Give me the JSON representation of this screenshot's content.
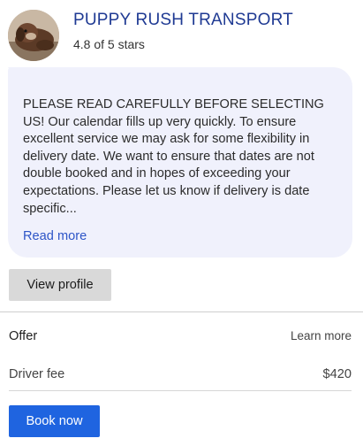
{
  "company": {
    "name": "PUPPY RUSH TRANSPORT",
    "rating_text": "4.8 of 5 stars",
    "avatar_icon": "dog-photo-avatar"
  },
  "description": {
    "text": "PLEASE READ CAREFULLY BEFORE SELECTING US! Our calendar fills up very quickly. To ensure excellent service we may ask for some flexibility in delivery date. We want to ensure that dates are not double booked and in hopes of exceeding your expectations. Please let us know if delivery is date specific...",
    "read_more_label": "Read more"
  },
  "actions": {
    "view_profile_label": "View profile",
    "book_now_label": "Book now"
  },
  "offer": {
    "title": "Offer",
    "learn_more_label": "Learn more",
    "fee_label": "Driver fee",
    "fee_value": "$420"
  },
  "colors": {
    "title": "#1f3a93",
    "link": "#2d55c7",
    "bubble_bg": "#f0f1fc",
    "primary_button": "#1f64e0",
    "secondary_button": "#d9d9d9"
  }
}
